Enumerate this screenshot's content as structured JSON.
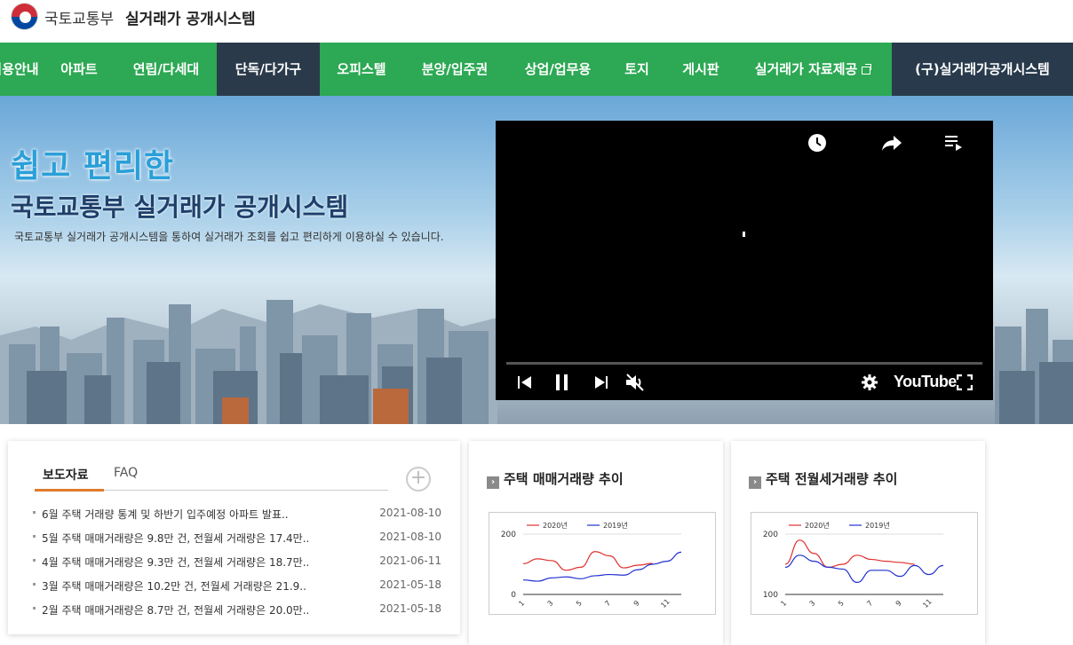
{
  "header": {
    "brand_ministry": "국토교통부",
    "brand_system": "실거래가 공개시스템"
  },
  "nav": {
    "items": [
      {
        "label": "이용안내"
      },
      {
        "label": "아파트"
      },
      {
        "label": "연립/다세대"
      },
      {
        "label": "단독/다가구",
        "active": true
      },
      {
        "label": "오피스텔"
      },
      {
        "label": "분양/입주권"
      },
      {
        "label": "상업/업무용"
      },
      {
        "label": "토지"
      },
      {
        "label": "게시판"
      },
      {
        "label": "실거래가 자료제공"
      },
      {
        "label": "(구)실거래가공개시스템"
      }
    ]
  },
  "hero": {
    "title_line1": "쉽고 편리한",
    "title_line2": "국토교통부 실거래가 공개시스템",
    "subtitle": "국토교통부 실거래가 공개시스템을 통하여 실거래가 조회를 쉽고 편리하게 이용하실 수 있습니다."
  },
  "video": {
    "brand": "YouTube",
    "icons": [
      "watch-later-icon",
      "share-icon",
      "playlist-icon",
      "previous-icon",
      "pause-icon",
      "next-icon",
      "mute-icon",
      "settings-icon",
      "fullscreen-icon"
    ]
  },
  "news": {
    "tabs": [
      "보도자료",
      "FAQ"
    ],
    "more_icon": "plus-icon",
    "items": [
      {
        "title": "6월 주택 거래량 통계 및 하반기 입주예정 아파트 발표..",
        "date": "2021-08-10"
      },
      {
        "title": "5월 주택 매매거래량은 9.8만 건, 전월세 거래량은 17.4만..",
        "date": "2021-08-10"
      },
      {
        "title": "4월 주택 매매거래량은 9.3만 건, 전월세 거래량은 18.7만..",
        "date": "2021-06-11"
      },
      {
        "title": "3월 주택 매매거래량은 10.2만 건, 전월세 거래량은 21.9..",
        "date": "2021-05-18"
      },
      {
        "title": "2월 주택 매매거래량은 8.7만 건, 전월세 거래량은 20.0만..",
        "date": "2021-05-18"
      }
    ]
  },
  "charts": {
    "sale_title": "주택 매매거래량 추이",
    "rent_title": "주택 전월세거래량 추이"
  },
  "chart_data": [
    {
      "type": "line",
      "title": "주택 매매거래량 추이",
      "x": [
        1,
        2,
        3,
        4,
        5,
        6,
        7,
        8,
        9,
        10,
        11,
        12
      ],
      "xticks": [
        "1",
        "3",
        "5",
        "7",
        "9",
        "11"
      ],
      "yticks": [
        "0",
        "200"
      ],
      "ylim": [
        0,
        200
      ],
      "series": [
        {
          "name": "2020년",
          "color": "#e03030",
          "values": [
            102,
            118,
            112,
            80,
            90,
            142,
            128,
            88,
            97,
            103,
            null,
            null
          ]
        },
        {
          "name": "2019년",
          "color": "#2030d0",
          "values": [
            48,
            44,
            55,
            58,
            52,
            62,
            66,
            64,
            82,
            100,
            110,
            140
          ]
        }
      ],
      "legend": "top"
    },
    {
      "type": "line",
      "title": "주택 전월세거래량 추이",
      "x": [
        1,
        2,
        3,
        4,
        5,
        6,
        7,
        8,
        9,
        10,
        11,
        12
      ],
      "xticks": [
        "1",
        "3",
        "5",
        "7",
        "9",
        "11"
      ],
      "yticks": [
        "100",
        "200"
      ],
      "ylim": [
        100,
        200
      ],
      "series": [
        {
          "name": "2020년",
          "color": "#e03030",
          "values": [
            150,
            190,
            168,
            145,
            150,
            165,
            158,
            155,
            153,
            150,
            null,
            null
          ]
        },
        {
          "name": "2019년",
          "color": "#2030d0",
          "values": [
            145,
            165,
            155,
            145,
            142,
            120,
            140,
            140,
            130,
            148,
            133,
            148
          ]
        }
      ],
      "legend": "top"
    }
  ]
}
